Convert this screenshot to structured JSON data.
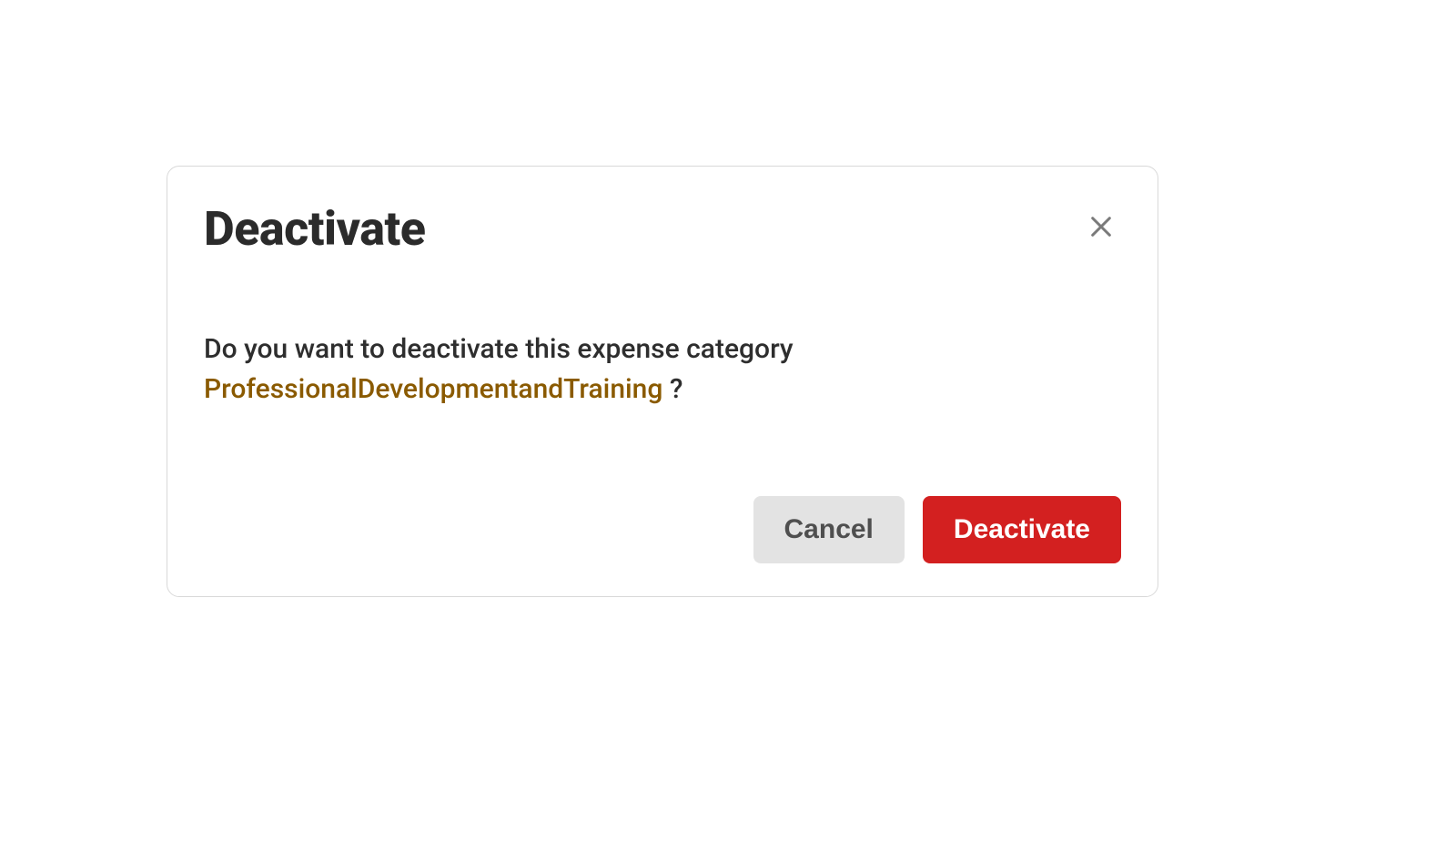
{
  "modal": {
    "title": "Deactivate",
    "message_prefix": "Do you want to deactivate this expense category ",
    "category_name": "ProfessionalDevelopmentandTraining",
    "message_suffix": " ?",
    "cancel_label": "Cancel",
    "confirm_label": "Deactivate"
  }
}
